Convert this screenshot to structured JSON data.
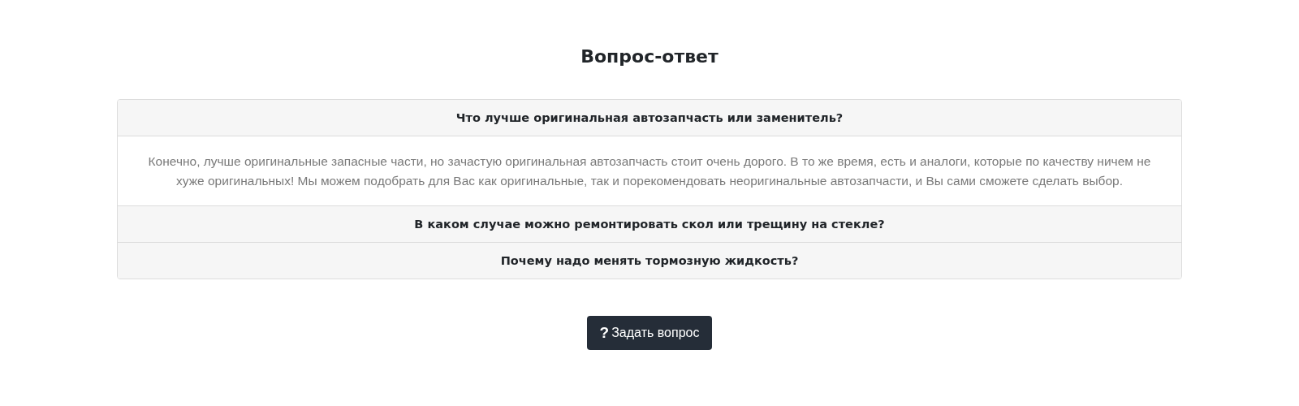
{
  "title": "Вопрос-ответ",
  "faq": [
    {
      "question": "Что лучше оригинальная автозапчасть или заменитель?",
      "expanded": true,
      "answer": "Конечно, лучше оригинальные запасные части, но зачастую оригинальная автозапчасть стоит очень дорого. В то же время, есть и аналоги, которые по качеству ничем не хуже оригинальных! Мы можем подобрать для Вас как оригинальные, так и порекомендовать неоригинальные автозапчасти, и Вы сами сможете сделать выбор."
    },
    {
      "question": "В каком случае можно ремонтировать скол или трещину на стекле?",
      "expanded": false
    },
    {
      "question": "Почему надо менять тормозную жидкость?",
      "expanded": false
    }
  ],
  "ask_button": {
    "icon": "?",
    "label": "Задать вопрос"
  }
}
